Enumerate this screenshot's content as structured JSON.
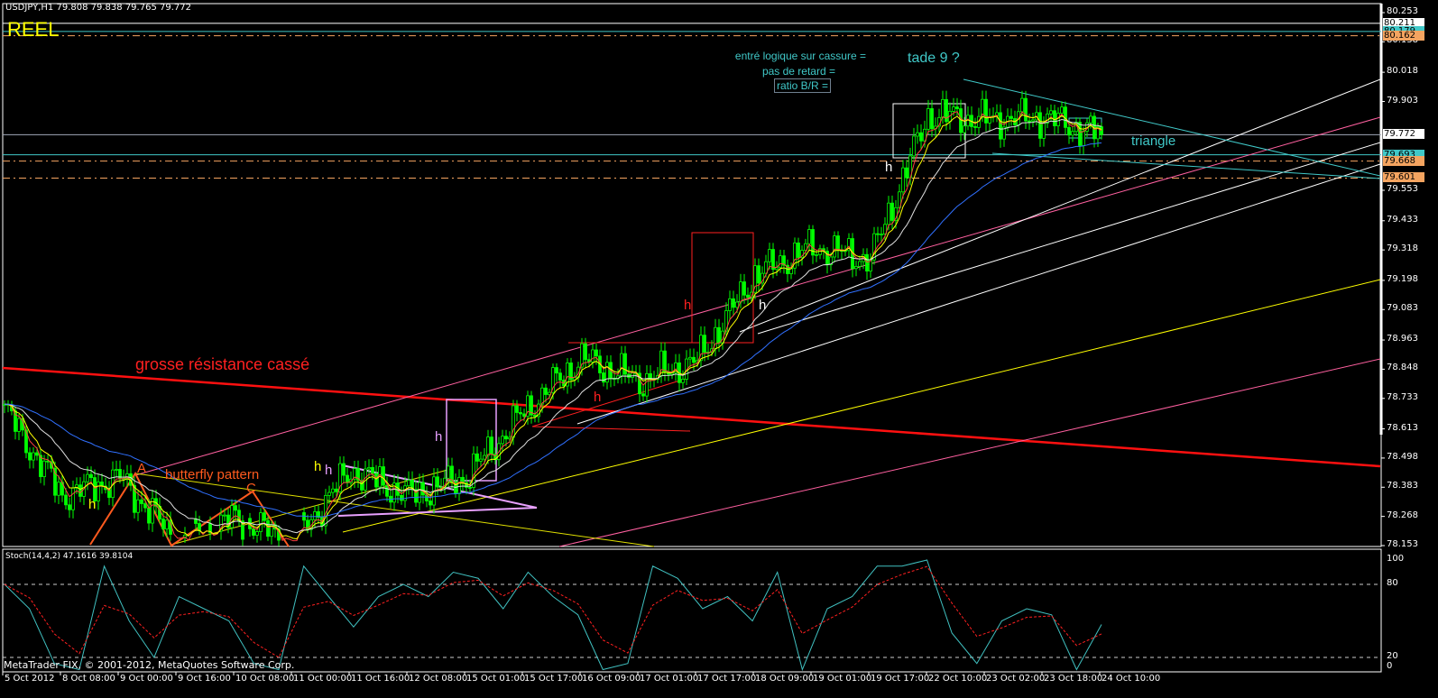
{
  "header": {
    "symbol_line": "USDJPY,H1  79.808 79.838 79.765 79.772",
    "account_label": "REEL"
  },
  "stoch_header": "Stoch(14,4,2) 47.1616 39.8104",
  "copyright": "MetaTrader FIX, © 2001-2012, MetaQuotes Software Corp.",
  "annotations": {
    "resistance": "grosse résistance cassé",
    "butterfly": "butterfly pattern",
    "point_a": "A",
    "point_c": "C",
    "h": "h",
    "entry": "entré logique sur cassure =",
    "no_delay": "pas de retard =",
    "ratio": "ratio B/R =",
    "trade": "tade 9 ?",
    "triangle": "triangle"
  },
  "colors": {
    "background": "#000000",
    "candle": "#00ff00",
    "resistance": "#ff0000",
    "stoch_main": "#40c0c0",
    "stoch_signal": "#ff2020",
    "annotation_cyan": "#40c8c8",
    "level_orange": "#f4a460"
  },
  "chart_data": {
    "type": "candlestick",
    "symbol": "USDJPY",
    "timeframe": "H1",
    "ylim": [
      78.153,
      80.253
    ],
    "price_ticks": [
      80.253,
      80.138,
      80.018,
      79.903,
      79.553,
      79.433,
      79.318,
      79.198,
      79.083,
      78.963,
      78.848,
      78.733,
      78.613,
      78.498,
      78.383,
      78.268,
      78.153
    ],
    "price_tags": [
      {
        "value": "80.211",
        "bg": "#ffffff"
      },
      {
        "value": "80.179",
        "bg": "#40c8c8"
      },
      {
        "value": "80.162",
        "bg": "#f4a460"
      },
      {
        "value": "79.772",
        "bg": "#ffffff"
      },
      {
        "value": "79.693",
        "bg": "#40c8c8"
      },
      {
        "value": "79.668",
        "bg": "#f4a460"
      },
      {
        "value": "79.601",
        "bg": "#f4a460"
      }
    ],
    "time_ticks": [
      "5 Oct 2012",
      "8 Oct 08:00",
      "9 Oct 00:00",
      "9 Oct 16:00",
      "10 Oct 08:00",
      "11 Oct 00:00",
      "11 Oct 16:00",
      "12 Oct 08:00",
      "15 Oct 01:00",
      "15 Oct 17:00",
      "16 Oct 09:00",
      "17 Oct 01:00",
      "17 Oct 17:00",
      "18 Oct 09:00",
      "19 Oct 01:00",
      "19 Oct 17:00",
      "22 Oct 10:00",
      "23 Oct 02:00",
      "23 Oct 18:00",
      "24 Oct 10:00"
    ],
    "close_at_time_ticks": [
      78.69,
      78.35,
      78.42,
      78.17,
      78.26,
      78.17,
      78.45,
      78.35,
      78.42,
      78.68,
      78.89,
      78.8,
      78.88,
      79.22,
      79.33,
      79.28,
      79.85,
      79.83,
      79.84,
      79.772
    ],
    "last_ohlc": {
      "open": 79.808,
      "high": 79.838,
      "low": 79.765,
      "close": 79.772
    },
    "stochastic": {
      "params": "14,4,2",
      "main": 47.1616,
      "signal": 39.8104,
      "levels": [
        80,
        20
      ],
      "ylim": [
        0,
        100
      ],
      "ticks": [
        100,
        80,
        20,
        0
      ],
      "main_samples": [
        80,
        60,
        15,
        10,
        95,
        50,
        20,
        70,
        60,
        50,
        15,
        10,
        95,
        70,
        45,
        70,
        80,
        70,
        90,
        85,
        60,
        90,
        70,
        55,
        10,
        15,
        95,
        85,
        60,
        70,
        50,
        90,
        10,
        60,
        70,
        95,
        95,
        100,
        40,
        15,
        50,
        60,
        55,
        10,
        47
      ]
    }
  }
}
